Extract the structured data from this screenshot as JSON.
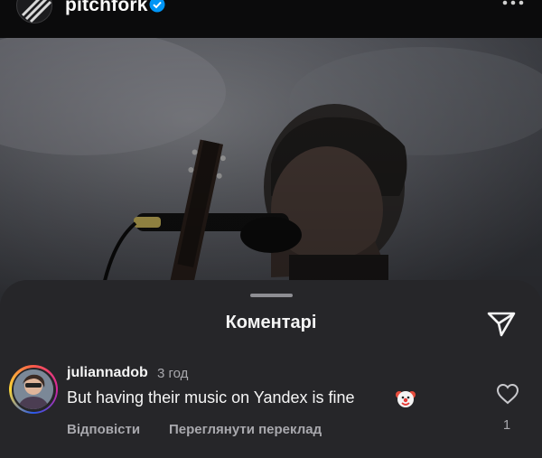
{
  "post": {
    "account_name": "pitchfork",
    "verified_icon": "verified-badge-icon",
    "more_icon": "more-dots-icon",
    "photo_description_icon": "concert-photo"
  },
  "comments_sheet": {
    "title": "Коментарі",
    "share_icon": "paper-plane-icon"
  },
  "comment": {
    "username": "juliannadob",
    "time": "3 год",
    "text": "But having their music on Yandex is fine",
    "emoji_icon": "clown-face-icon",
    "reply_label": "Відповісти",
    "translate_label": "Переглянути переклад",
    "like_icon": "heart-icon",
    "like_count": "1"
  },
  "colors": {
    "sheet_background": "#262629",
    "secondary_text": "#a8a8ad",
    "primary_text": "#f5f5f5"
  }
}
